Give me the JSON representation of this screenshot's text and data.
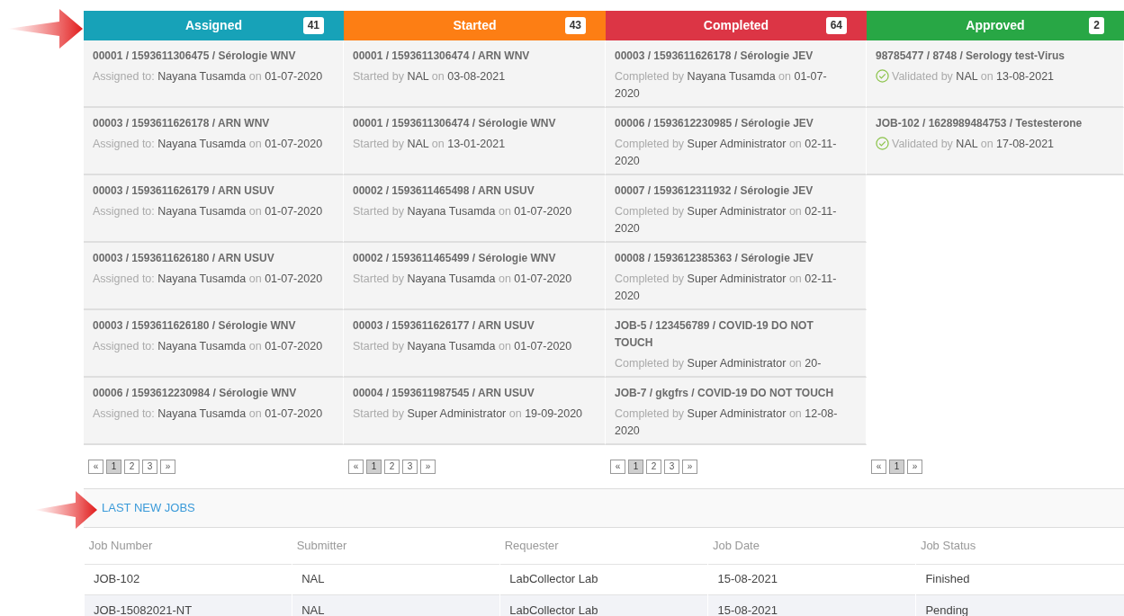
{
  "columns": [
    {
      "title": "Assigned",
      "count": "41",
      "color": "#17a2b8",
      "cards": [
        {
          "title": "00001 / 1593611306475 / Sérologie WNV",
          "prefix": "Assigned to:",
          "person": "Nayana Tusamda",
          "on": "on",
          "date": "01-07-2020"
        },
        {
          "title": "00003 / 1593611626178 / ARN WNV",
          "prefix": "Assigned to:",
          "person": "Nayana Tusamda",
          "on": "on",
          "date": "01-07-2020"
        },
        {
          "title": "00003 / 1593611626179 / ARN USUV",
          "prefix": "Assigned to:",
          "person": "Nayana Tusamda",
          "on": "on",
          "date": "01-07-2020"
        },
        {
          "title": "00003 / 1593611626180 / ARN USUV",
          "prefix": "Assigned to:",
          "person": "Nayana Tusamda",
          "on": "on",
          "date": "01-07-2020"
        },
        {
          "title": "00003 / 1593611626180 / Sérologie WNV",
          "prefix": "Assigned to:",
          "person": "Nayana Tusamda",
          "on": "on",
          "date": "01-07-2020"
        },
        {
          "title": "00006 / 1593612230984 / Sérologie WNV",
          "prefix": "Assigned to:",
          "person": "Nayana Tusamda",
          "on": "on",
          "date": "01-07-2020"
        }
      ],
      "pages": [
        {
          "label": "«",
          "selected": false
        },
        {
          "label": "1",
          "selected": true
        },
        {
          "label": "2",
          "selected": false
        },
        {
          "label": "3",
          "selected": false
        },
        {
          "label": "»",
          "selected": false
        }
      ]
    },
    {
      "title": "Started",
      "count": "43",
      "color": "#fd7e14",
      "cards": [
        {
          "title": "00001 / 1593611306474 / ARN WNV",
          "prefix": "Started by",
          "person": "NAL",
          "on": "on",
          "date": "03-08-2021"
        },
        {
          "title": "00001 / 1593611306474 / Sérologie WNV",
          "prefix": "Started by",
          "person": "NAL",
          "on": "on",
          "date": "13-01-2021"
        },
        {
          "title": "00002 / 1593611465498 / ARN USUV",
          "prefix": "Started by",
          "person": "Nayana Tusamda",
          "on": "on",
          "date": "01-07-2020"
        },
        {
          "title": "00002 / 1593611465499 / Sérologie WNV",
          "prefix": "Started by",
          "person": "Nayana Tusamda",
          "on": "on",
          "date": "01-07-2020"
        },
        {
          "title": "00003 / 1593611626177 / ARN USUV",
          "prefix": "Started by",
          "person": "Nayana Tusamda",
          "on": "on",
          "date": "01-07-2020"
        },
        {
          "title": "00004 / 1593611987545 / ARN USUV",
          "prefix": "Started by",
          "person": "Super Administrator",
          "on": "on",
          "date": "19-09-2020"
        }
      ],
      "pages": [
        {
          "label": "«",
          "selected": false
        },
        {
          "label": "1",
          "selected": true
        },
        {
          "label": "2",
          "selected": false
        },
        {
          "label": "3",
          "selected": false
        },
        {
          "label": "»",
          "selected": false
        }
      ]
    },
    {
      "title": "Completed",
      "count": "64",
      "color": "#dc3545",
      "cards": [
        {
          "title": "00003 / 1593611626178 / Sérologie JEV",
          "prefix": "Completed by",
          "person": "Nayana Tusamda",
          "on": "on",
          "date": "01-07-2020"
        },
        {
          "title": "00006 / 1593612230985 / Sérologie JEV",
          "prefix": "Completed by",
          "person": "Super Administrator",
          "on": "on",
          "date": "02-11-2020"
        },
        {
          "title": "00007 / 1593612311932 / Sérologie JEV",
          "prefix": "Completed by",
          "person": "Super Administrator",
          "on": "on",
          "date": "02-11-2020"
        },
        {
          "title": "00008 / 1593612385363 / Sérologie JEV",
          "prefix": "Completed by",
          "person": "Super Administrator",
          "on": "on",
          "date": "02-11-2020"
        },
        {
          "title": "JOB-5 / 123456789 / COVID-19 DO NOT TOUCH",
          "prefix": "Completed by",
          "person": "Super Administrator",
          "on": "on",
          "date": "20-"
        },
        {
          "title": "JOB-7 / gkgfrs / COVID-19 DO NOT TOUCH",
          "prefix": "Completed by",
          "person": "Super Administrator",
          "on": "on",
          "date": "12-08-2020"
        }
      ],
      "pages": [
        {
          "label": "«",
          "selected": false
        },
        {
          "label": "1",
          "selected": true
        },
        {
          "label": "2",
          "selected": false
        },
        {
          "label": "3",
          "selected": false
        },
        {
          "label": "»",
          "selected": false
        }
      ]
    },
    {
      "title": "Approved",
      "count": "2",
      "color": "#28a745",
      "cards": [
        {
          "title": "98785477 / 8748 / Serology test-Virus",
          "validated": true,
          "prefix": "Validated by",
          "person": "NAL",
          "on": "on",
          "date": "13-08-2021"
        },
        {
          "title": "JOB-102 / 1628989484753 / Testesterone",
          "validated": true,
          "prefix": "Validated by",
          "person": "NAL",
          "on": "on",
          "date": "17-08-2021"
        }
      ],
      "pages": [
        {
          "label": "«",
          "selected": false
        },
        {
          "label": "1",
          "selected": true
        },
        {
          "label": "»",
          "selected": false
        }
      ]
    }
  ],
  "last_new_jobs": {
    "title": "LAST NEW JOBS",
    "table": {
      "columns": [
        "Job Number",
        "Submitter",
        "Requester",
        "Job Date",
        "Job Status"
      ],
      "rows": [
        [
          "JOB-102",
          "NAL",
          "LabCollector Lab",
          "15-08-2021",
          "Finished"
        ],
        [
          "JOB-15082021-NT",
          "NAL",
          "LabCollector Lab",
          "15-08-2021",
          "Pending"
        ]
      ]
    }
  }
}
